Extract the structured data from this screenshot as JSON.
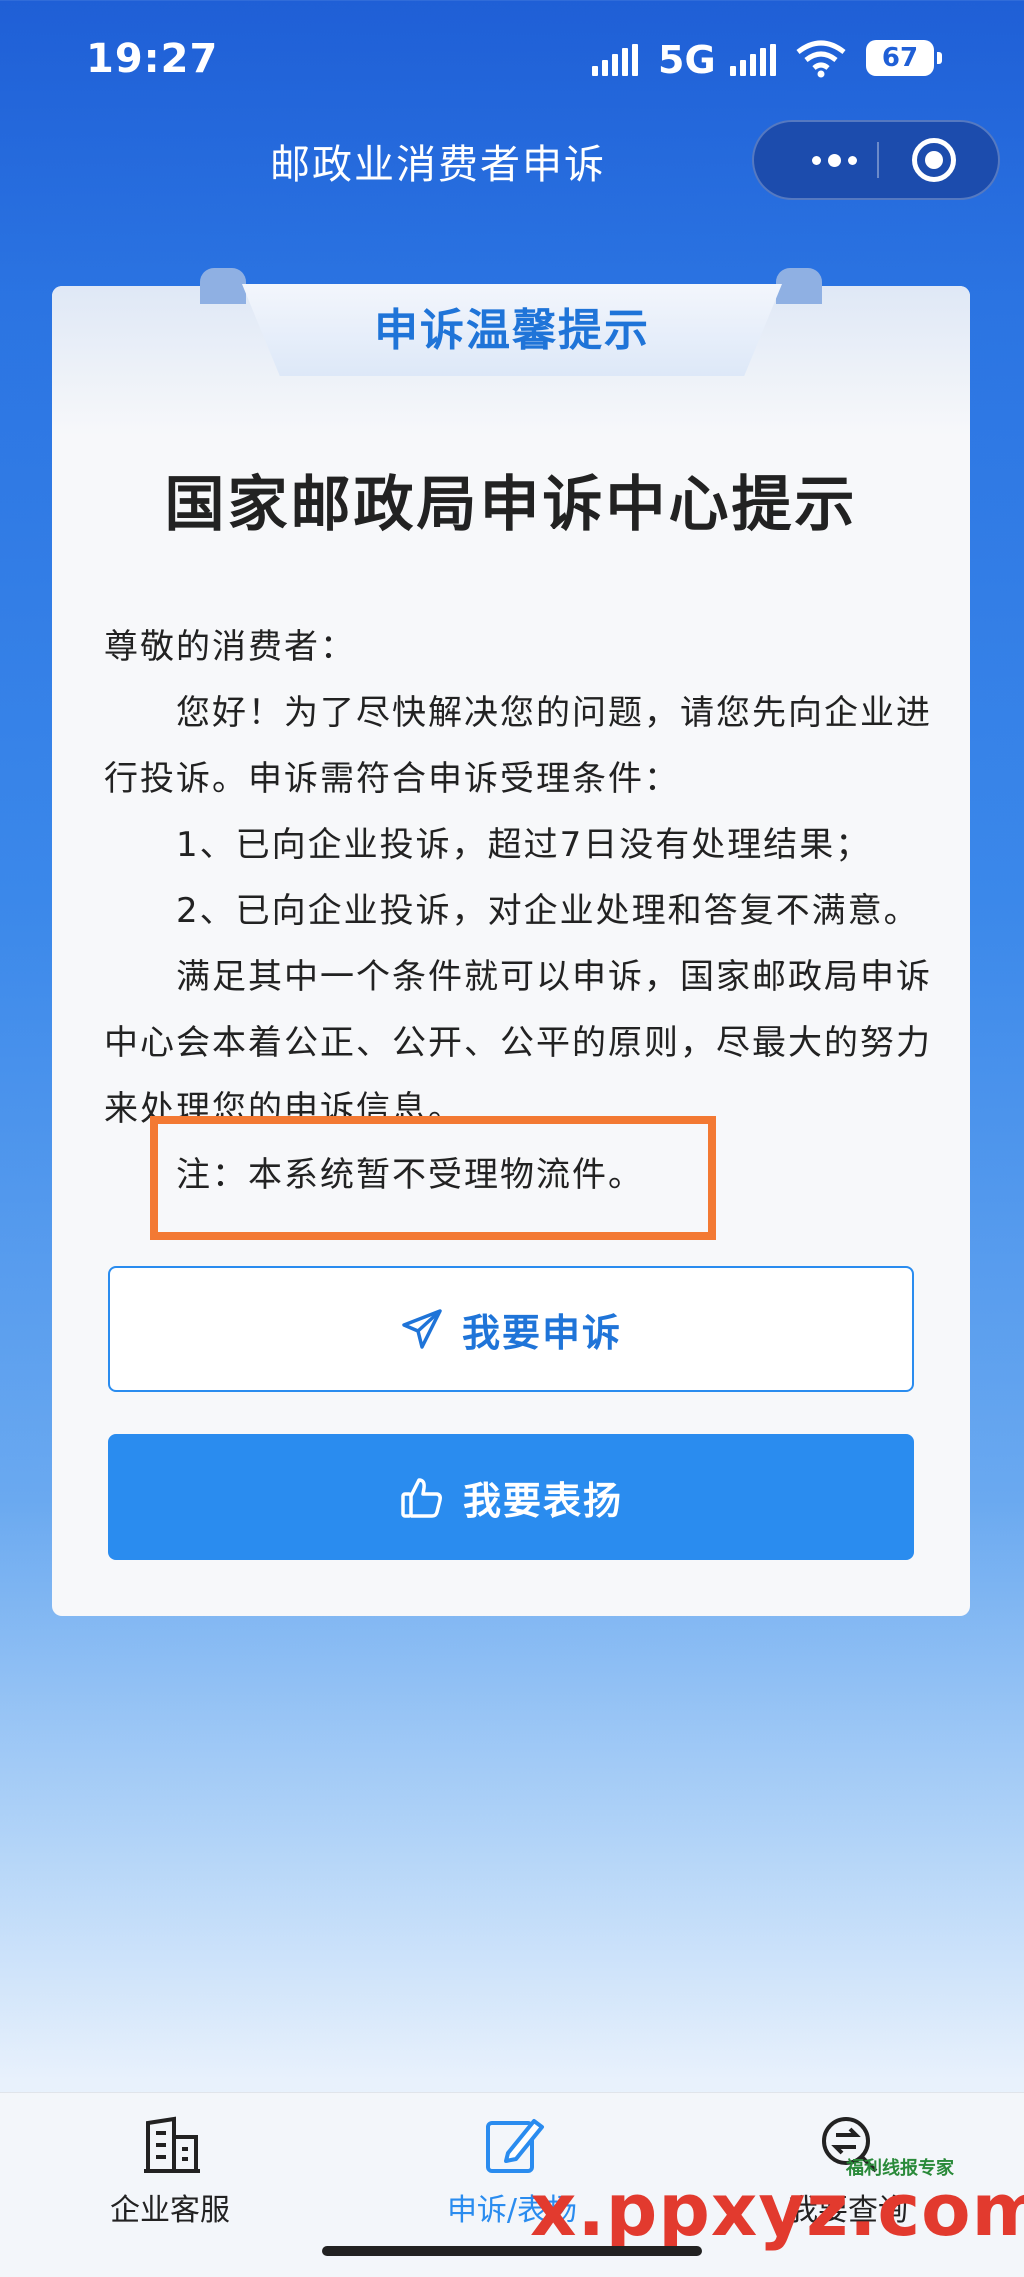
{
  "status_bar": {
    "time": "19:27",
    "network": "5G",
    "battery": "67"
  },
  "nav": {
    "title": "邮政业消费者申诉"
  },
  "card": {
    "ribbon_title": "申诉温馨提示",
    "title": "国家邮政局申诉中心提示",
    "greeting": "尊敬的消费者：",
    "para1": "　　您好！为了尽快解决您的问题，请您先向企业进行投诉。申诉需符合申诉受理条件：",
    "cond1": "　　1、已向企业投诉，超过7日没有处理结果；",
    "cond2": "　　2、已向企业投诉，对企业处理和答复不满意。",
    "para2": "　　满足其中一个条件就可以申诉，国家邮政局申诉中心会本着公正、公开、公平的原则，尽最大的努力来处理您的申诉信息。",
    "note": "　　注：本系统暂不受理物流件。"
  },
  "buttons": {
    "complain": "我要申诉",
    "praise": "我要表扬"
  },
  "tabs": [
    {
      "label": "企业客服",
      "icon": "building-icon"
    },
    {
      "label": "申诉/表扬",
      "icon": "edit-icon"
    },
    {
      "label": "我要查询",
      "icon": "search-exchange-icon"
    }
  ],
  "watermark": {
    "text": "x.ppxyz.com",
    "badge": "福利线报专家"
  },
  "colors": {
    "primary": "#2a8cef",
    "highlight_border": "#f37933",
    "nav_bg": "#1f5fd6"
  }
}
